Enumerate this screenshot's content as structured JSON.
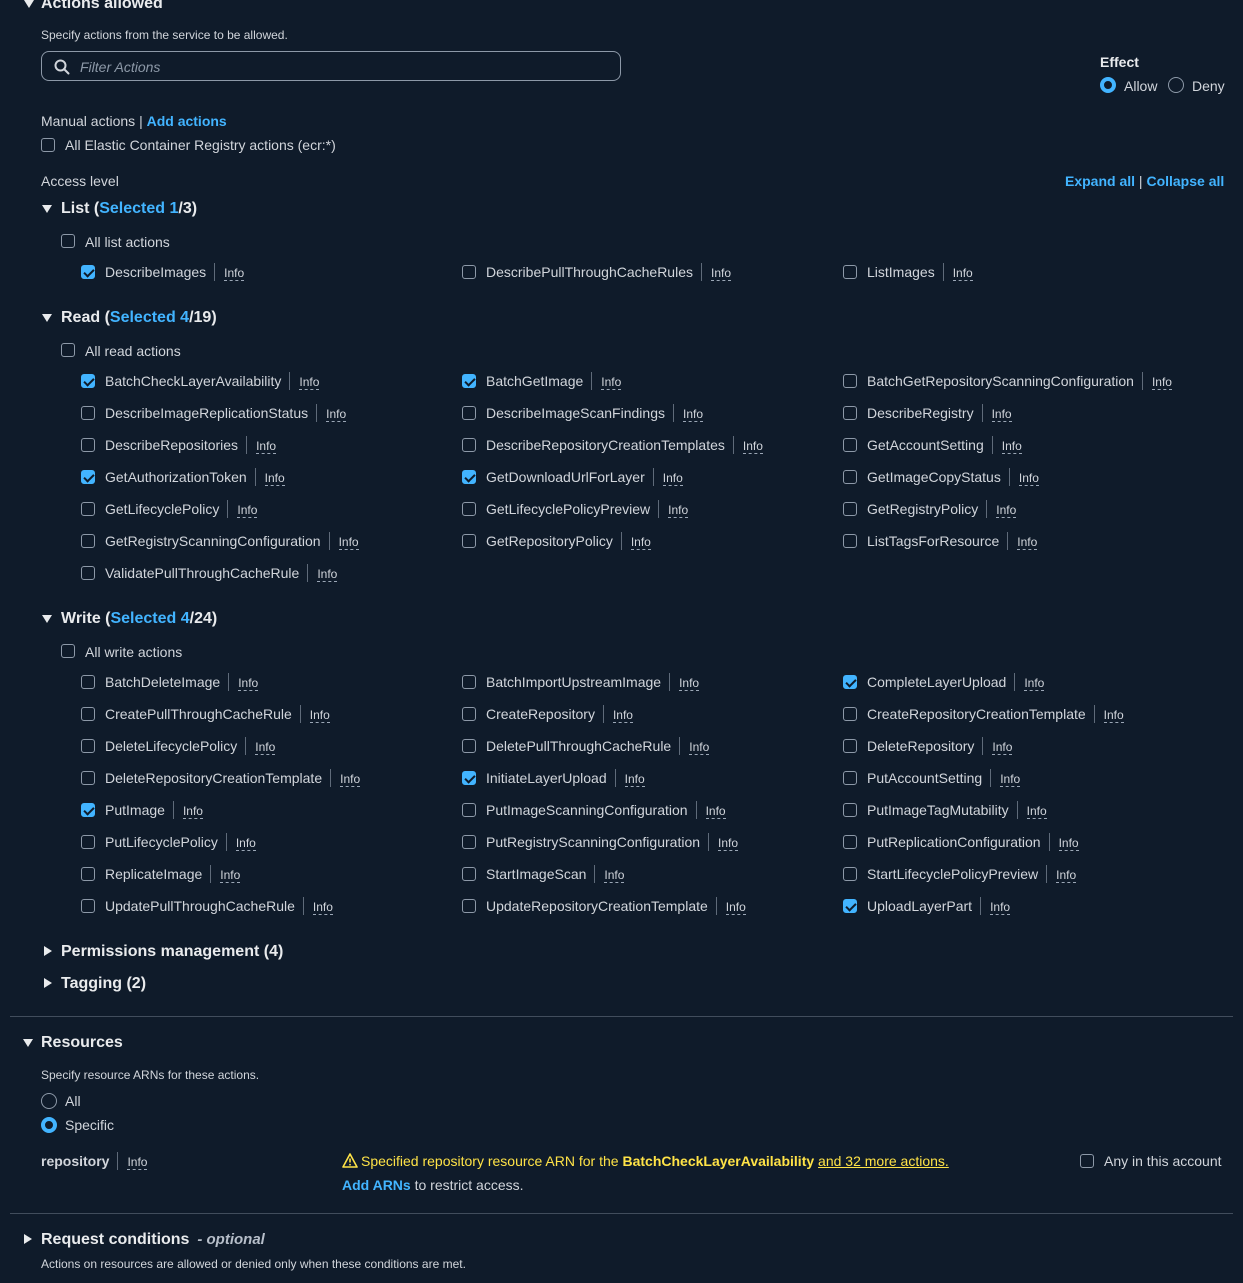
{
  "actions_allowed": {
    "title": "Actions allowed",
    "description": "Specify actions from the service to be allowed.",
    "filter_placeholder": "Filter Actions",
    "effect": {
      "label": "Effect",
      "allow": "Allow",
      "deny": "Deny",
      "selected": "Allow"
    },
    "manual_actions": "Manual actions",
    "pipe": "|",
    "add_actions": "Add actions",
    "all_ecr": "All Elastic Container Registry actions (ecr:*)",
    "access_level": "Access level",
    "expand_all": "Expand all",
    "collapse_all": "Collapse all"
  },
  "info_label": "Info",
  "groups": {
    "list": {
      "name": "List (",
      "selected_word": "Selected",
      "selected_count": "1",
      "total": "/3)",
      "all_label": "All list actions",
      "actions": [
        {
          "name": "DescribeImages",
          "checked": true
        },
        {
          "name": "DescribePullThroughCacheRules",
          "checked": false
        },
        {
          "name": "ListImages",
          "checked": false
        }
      ]
    },
    "read": {
      "name": "Read (",
      "selected_word": "Selected",
      "selected_count": "4",
      "total": "/19)",
      "all_label": "All read actions",
      "actions": [
        {
          "name": "BatchCheckLayerAvailability",
          "checked": true
        },
        {
          "name": "BatchGetImage",
          "checked": true
        },
        {
          "name": "BatchGetRepositoryScanningConfiguration",
          "checked": false
        },
        {
          "name": "DescribeImageReplicationStatus",
          "checked": false
        },
        {
          "name": "DescribeImageScanFindings",
          "checked": false
        },
        {
          "name": "DescribeRegistry",
          "checked": false
        },
        {
          "name": "DescribeRepositories",
          "checked": false
        },
        {
          "name": "DescribeRepositoryCreationTemplates",
          "checked": false
        },
        {
          "name": "GetAccountSetting",
          "checked": false
        },
        {
          "name": "GetAuthorizationToken",
          "checked": true
        },
        {
          "name": "GetDownloadUrlForLayer",
          "checked": true
        },
        {
          "name": "GetImageCopyStatus",
          "checked": false
        },
        {
          "name": "GetLifecyclePolicy",
          "checked": false
        },
        {
          "name": "GetLifecyclePolicyPreview",
          "checked": false
        },
        {
          "name": "GetRegistryPolicy",
          "checked": false
        },
        {
          "name": "GetRegistryScanningConfiguration",
          "checked": false
        },
        {
          "name": "GetRepositoryPolicy",
          "checked": false
        },
        {
          "name": "ListTagsForResource",
          "checked": false
        },
        {
          "name": "ValidatePullThroughCacheRule",
          "checked": false
        }
      ]
    },
    "write": {
      "name": "Write (",
      "selected_word": "Selected",
      "selected_count": "4",
      "total": "/24)",
      "all_label": "All write actions",
      "actions": [
        {
          "name": "BatchDeleteImage",
          "checked": false
        },
        {
          "name": "BatchImportUpstreamImage",
          "checked": false
        },
        {
          "name": "CompleteLayerUpload",
          "checked": true
        },
        {
          "name": "CreatePullThroughCacheRule",
          "checked": false
        },
        {
          "name": "CreateRepository",
          "checked": false
        },
        {
          "name": "CreateRepositoryCreationTemplate",
          "checked": false
        },
        {
          "name": "DeleteLifecyclePolicy",
          "checked": false
        },
        {
          "name": "DeletePullThroughCacheRule",
          "checked": false
        },
        {
          "name": "DeleteRepository",
          "checked": false
        },
        {
          "name": "DeleteRepositoryCreationTemplate",
          "checked": false
        },
        {
          "name": "InitiateLayerUpload",
          "checked": true
        },
        {
          "name": "PutAccountSetting",
          "checked": false
        },
        {
          "name": "PutImage",
          "checked": true
        },
        {
          "name": "PutImageScanningConfiguration",
          "checked": false
        },
        {
          "name": "PutImageTagMutability",
          "checked": false
        },
        {
          "name": "PutLifecyclePolicy",
          "checked": false
        },
        {
          "name": "PutRegistryScanningConfiguration",
          "checked": false
        },
        {
          "name": "PutReplicationConfiguration",
          "checked": false
        },
        {
          "name": "ReplicateImage",
          "checked": false
        },
        {
          "name": "StartImageScan",
          "checked": false
        },
        {
          "name": "StartLifecyclePolicyPreview",
          "checked": false
        },
        {
          "name": "UpdatePullThroughCacheRule",
          "checked": false
        },
        {
          "name": "UpdateRepositoryCreationTemplate",
          "checked": false
        },
        {
          "name": "UploadLayerPart",
          "checked": true
        }
      ]
    }
  },
  "collapsed": {
    "permissions": "Permissions management (4)",
    "tagging": "Tagging (2)"
  },
  "resources": {
    "title": "Resources",
    "description": "Specify resource ARNs for these actions.",
    "all": "All",
    "specific": "Specific",
    "selected": "Specific",
    "repository_label": "repository",
    "warning_prefix": "Specified repository resource ARN for the ",
    "warning_action": "BatchCheckLayerAvailability",
    "warning_more": "and 32 more actions.",
    "add_arns": "Add ARNs",
    "restrict": "to restrict access.",
    "any_account": "Any in this account"
  },
  "request_conditions": {
    "title": "Request conditions",
    "optional": "- optional",
    "description": "Actions on resources are allowed or denied only when these conditions are met."
  },
  "colors": {
    "background": "#0f1b2a",
    "accent": "#42b4ff",
    "warning": "#ffe347",
    "text": "#d1d5db"
  }
}
